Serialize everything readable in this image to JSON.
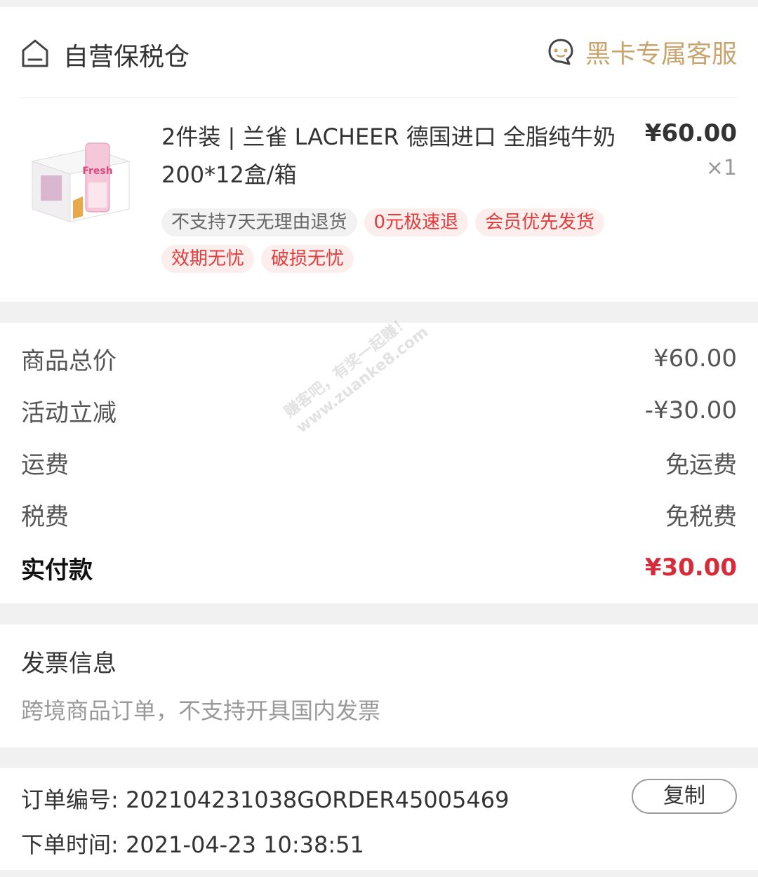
{
  "store": {
    "name": "自营保税仓",
    "service_label": "黑卡专属客服",
    "service_color": "#c8a46e"
  },
  "product": {
    "title": "2件装 | 兰雀 LACHEER 德国进口 全脂纯牛奶 200*12盒/箱",
    "price": "¥60.00",
    "qty": "×1",
    "image_text": "Fresh",
    "tags": [
      {
        "label": "不支持7天无理由退货",
        "style": "gray"
      },
      {
        "label": "0元极速退",
        "style": "red"
      },
      {
        "label": "会员优先发货",
        "style": "red"
      },
      {
        "label": "效期无忧",
        "style": "red"
      },
      {
        "label": "破损无忧",
        "style": "red"
      }
    ]
  },
  "summary": {
    "rows": [
      {
        "key": "商品总价",
        "value": "¥60.00"
      },
      {
        "key": "活动立减",
        "value": "-¥30.00"
      },
      {
        "key": "运费",
        "value": "免运费"
      },
      {
        "key": "税费",
        "value": "免税费"
      }
    ],
    "total": {
      "key": "实付款",
      "value": "¥30.00"
    },
    "total_color": "#d62c3a"
  },
  "invoice": {
    "title": "发票信息",
    "desc": "跨境商品订单，不支持开具国内发票"
  },
  "order": {
    "number_label": "订单编号: ",
    "number_value": "202104231038GORDER45005469",
    "time_label": "下单时间: ",
    "time_value": "2021-04-23 10:38:51",
    "copy_label": "复制"
  },
  "watermark": {
    "line1": "赚客吧，有奖一起赚！",
    "line2": "www.zuanke8.com"
  }
}
